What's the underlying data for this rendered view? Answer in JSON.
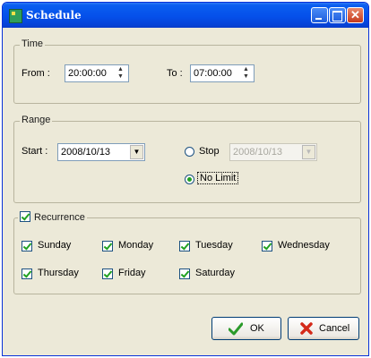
{
  "window": {
    "title": "Schedule"
  },
  "time": {
    "group_label": "Time",
    "from_label": "From :",
    "from_value": "20:00:00",
    "to_label": "To :",
    "to_value": "07:00:00"
  },
  "range": {
    "group_label": "Range",
    "start_label": "Start :",
    "start_value": "2008/10/13",
    "stop_label": "Stop",
    "stop_value": "2008/10/13",
    "nolimit_label": "No Limit",
    "selected": "No Limit"
  },
  "recurrence": {
    "label": "Recurrence",
    "checked": true,
    "days": [
      {
        "label": "Sunday",
        "checked": true
      },
      {
        "label": "Monday",
        "checked": true
      },
      {
        "label": "Tuesday",
        "checked": true
      },
      {
        "label": "Wednesday",
        "checked": true
      },
      {
        "label": "Thursday",
        "checked": true
      },
      {
        "label": "Friday",
        "checked": true
      },
      {
        "label": "Saturday",
        "checked": true
      }
    ]
  },
  "buttons": {
    "ok_label": "OK",
    "cancel_label": "Cancel"
  }
}
